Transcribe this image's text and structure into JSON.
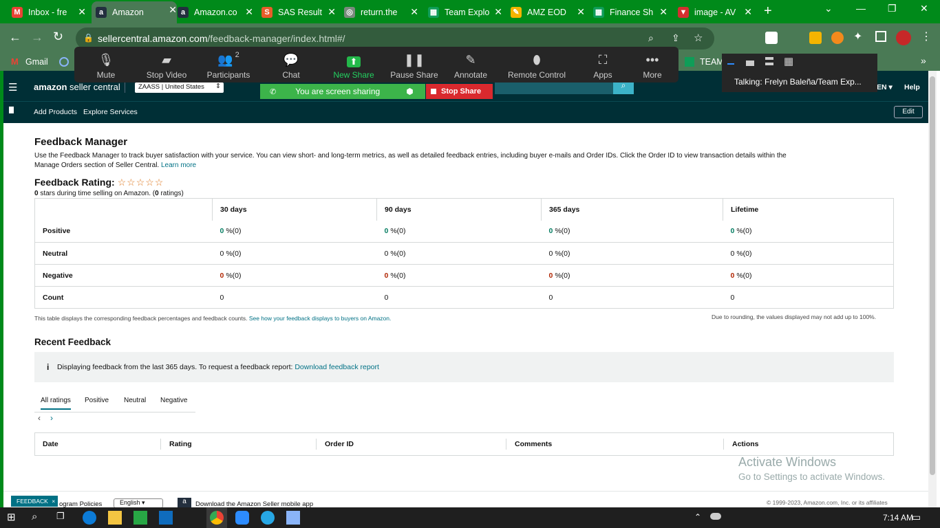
{
  "browser": {
    "tabs": [
      {
        "title": "Inbox - fre",
        "icon": "gmail-icon",
        "color": "#ea4335",
        "glyph": "M"
      },
      {
        "title": "Amazon",
        "icon": "amazon-icon",
        "color": "#232f3e",
        "glyph": "a"
      },
      {
        "title": "Amazon.co",
        "icon": "amazon-icon",
        "color": "#232f3e",
        "glyph": "a"
      },
      {
        "title": "SAS Result",
        "icon": "sas-icon",
        "color": "#e85d2a",
        "glyph": "S"
      },
      {
        "title": "return.the",
        "icon": "globe-icon",
        "color": "#7a8a7d",
        "glyph": "◎"
      },
      {
        "title": "Team Explo",
        "icon": "sheets-icon",
        "color": "#0f9d58",
        "glyph": "▦"
      },
      {
        "title": "AMZ EOD",
        "icon": "pencil-app-icon",
        "color": "#f4b400",
        "glyph": "✎"
      },
      {
        "title": "Finance Sh",
        "icon": "sheets-icon",
        "color": "#0f9d58",
        "glyph": "▦"
      },
      {
        "title": "image - AV",
        "icon": "av-icon",
        "color": "#d32f2f",
        "glyph": "▼"
      }
    ],
    "url_host": "sellercentral.amazon.com",
    "url_path": "/feedback-manager/index.html#/",
    "bookmarks": {
      "gmail": "Gmail",
      "team": "TEAM"
    }
  },
  "zoom": {
    "buttons": [
      {
        "label": "Mute",
        "icon": "microphone-icon"
      },
      {
        "label": "Stop Video",
        "icon": "video-camera-icon"
      },
      {
        "label": "Participants",
        "icon": "participants-icon",
        "badge": "2"
      },
      {
        "label": "Chat",
        "icon": "chat-icon"
      },
      {
        "label": "New Share",
        "icon": "share-screen-icon"
      },
      {
        "label": "Pause Share",
        "icon": "pause-icon"
      },
      {
        "label": "Annotate",
        "icon": "pen-icon"
      },
      {
        "label": "Remote Control",
        "icon": "mouse-icon"
      },
      {
        "label": "Apps",
        "icon": "apps-icon"
      },
      {
        "label": "More",
        "icon": "more-dots-icon"
      }
    ],
    "sharing_text": "You are screen sharing",
    "stop_share": "Stop Share",
    "talking": "Talking: Frelyn Baleña/Team Exp..."
  },
  "seller": {
    "logo_amazon": "amazon",
    "logo_rest": "seller central",
    "account": "ZAASS | United States",
    "lang": "EN",
    "help": "Help",
    "add_products": "Add Products",
    "explore_services": "Explore Services",
    "edit": "Edit"
  },
  "page": {
    "title": "Feedback Manager",
    "intro": "Use the Feedback Manager to track buyer satisfaction with your service. You can view short- and long-term metrics, as well as detailed feedback entries, including buyer e-mails and Order IDs. Click the Order ID to view transaction details within the",
    "intro2": "Manage Orders section of Seller Central.",
    "learn_more": "Learn more",
    "rating_title": "Feedback Rating:",
    "stars": 0,
    "stars_zero": "0",
    "stars_text": "stars during time selling on Amazon. (",
    "ratings_zero": "0",
    "ratings_text": "ratings)",
    "table": {
      "headers": [
        "30 days",
        "90 days",
        "365 days",
        "Lifetime"
      ],
      "rows": [
        {
          "label": "Positive",
          "cells": [
            "0",
            "0",
            "0",
            "0"
          ],
          "suffix": "%(0)",
          "tone": "g"
        },
        {
          "label": "Neutral",
          "cells": [
            "0",
            "0",
            "0",
            "0"
          ],
          "suffix": "%(0)",
          "tone": ""
        },
        {
          "label": "Negative",
          "cells": [
            "0",
            "0",
            "0",
            "0"
          ],
          "suffix": "%(0)",
          "tone": "r"
        },
        {
          "label": "Count",
          "cells": [
            "0",
            "0",
            "0",
            "0"
          ],
          "suffix": "",
          "tone": ""
        }
      ]
    },
    "table_note": "This table displays the corresponding feedback percentages and feedback counts.",
    "table_note_link": "See how your feedback displays to buyers on Amazon.",
    "rounding_note": "Due to rounding, the values displayed may not add up to 100%.",
    "recent_title": "Recent Feedback",
    "info_text": "Displaying feedback from the last 365 days. To request a feedback report:",
    "download_link": "Download feedback report",
    "filter_tabs": [
      "All ratings",
      "Positive",
      "Neutral",
      "Negative"
    ],
    "recent_headers": [
      "Date",
      "Rating",
      "Order ID",
      "Comments",
      "Actions"
    ],
    "activate_title": "Activate Windows",
    "activate_sub": "Go to Settings to activate Windows.",
    "feedback_btn": "FEEDBACK",
    "program_policies": "ogram Policies",
    "footer_lang": "English",
    "download_app": "Download the Amazon Seller mobile app",
    "copyright": "© 1999-2023, Amazon.com, Inc. or its affiliates"
  },
  "taskbar": {
    "time": "7:14 AM"
  }
}
